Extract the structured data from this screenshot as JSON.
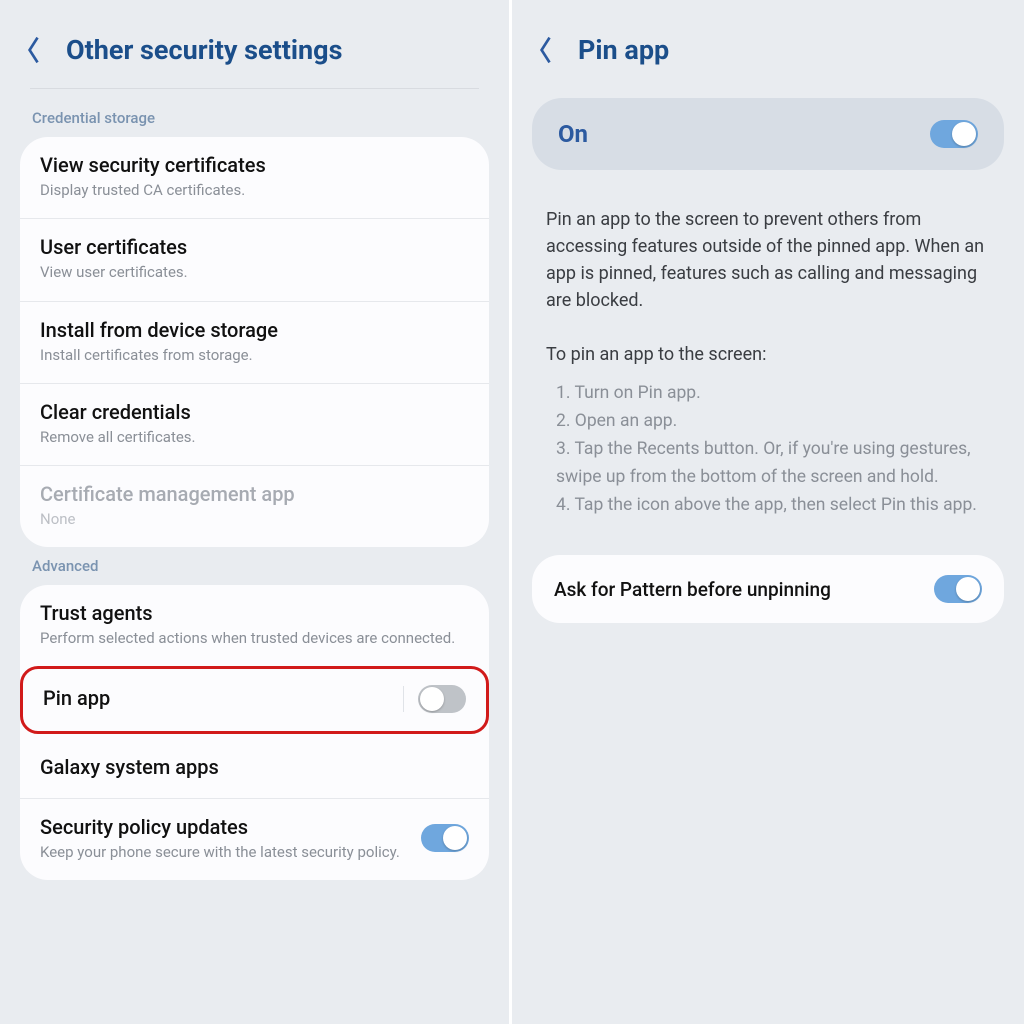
{
  "left": {
    "title": "Other security settings",
    "section_credential": "Credential storage",
    "rows_credential": [
      {
        "title": "View security certificates",
        "sub": "Display trusted CA certificates."
      },
      {
        "title": "User certificates",
        "sub": "View user certificates."
      },
      {
        "title": "Install from device storage",
        "sub": "Install certificates from storage."
      },
      {
        "title": "Clear credentials",
        "sub": "Remove all certificates."
      },
      {
        "title": "Certificate management app",
        "sub": "None"
      }
    ],
    "section_advanced": "Advanced",
    "trust_agents": {
      "title": "Trust agents",
      "sub": "Perform selected actions when trusted devices are connected."
    },
    "pin_app": {
      "title": "Pin app"
    },
    "galaxy": {
      "title": "Galaxy system apps"
    },
    "security_policy": {
      "title": "Security policy updates",
      "sub": "Keep your phone secure with the latest security policy."
    }
  },
  "right": {
    "title": "Pin app",
    "on_label": "On",
    "desc": "Pin an app to the screen to prevent others from accessing features outside of the pinned app. When an app is pinned, features such as calling and messaging are blocked.",
    "steps_heading": "To pin an app to the screen:",
    "steps": [
      "1. Turn on Pin app.",
      "2. Open an app.",
      "3. Tap the Recents button. Or, if you're using gestures, swipe up from the bottom of the screen and hold.",
      "4. Tap the icon above the app, then select Pin this app."
    ],
    "ask_label": "Ask for Pattern before unpinning"
  }
}
